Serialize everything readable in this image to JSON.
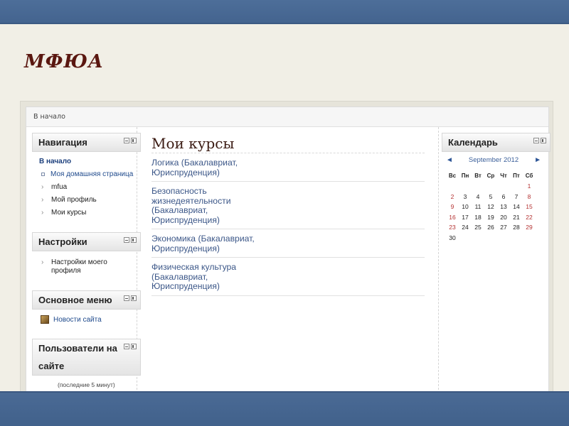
{
  "site": {
    "logo": "МФЮА"
  },
  "breadcrumb": {
    "home": "В начало"
  },
  "navigation": {
    "title": "Навигация",
    "home": "В начало",
    "items": [
      {
        "label": "Моя домашняя страница",
        "type": "square"
      },
      {
        "label": "mfua",
        "type": "chevron"
      },
      {
        "label": "Мой профиль",
        "type": "chevron"
      },
      {
        "label": "Мои курсы",
        "type": "chevron"
      }
    ]
  },
  "settings": {
    "title": "Настройки",
    "items": [
      {
        "label": "Настройки моего профиля"
      }
    ]
  },
  "main_menu": {
    "title": "Основное меню",
    "items": [
      {
        "label": "Новости сайта",
        "icon": "forum-icon"
      }
    ]
  },
  "online_users": {
    "title": "Пользователи на сайте",
    "note": "(последние 5 минут)"
  },
  "main": {
    "title": "Мои курсы",
    "courses": [
      {
        "name": "Логика (Бакалавриат, Юриспруденция)"
      },
      {
        "name": "Безопасность жизнедеятельности (Бакалавриат, Юриспруденция)"
      },
      {
        "name": "Экономика (Бакалавриат, Юриспруденция)"
      },
      {
        "name": "Физическая культура (Бакалавриат, Юриспруденция)"
      }
    ]
  },
  "calendar": {
    "title": "Календарь",
    "month": "September 2012",
    "prev": "◄",
    "next": "►",
    "weekdays": [
      "Вс",
      "Пн",
      "Вт",
      "Ср",
      "Чт",
      "Пт",
      "Сб"
    ],
    "weeks": [
      [
        "",
        "",
        "",
        "",
        "",
        "",
        "1"
      ],
      [
        "2",
        "3",
        "4",
        "5",
        "6",
        "7",
        "8"
      ],
      [
        "9",
        "10",
        "11",
        "12",
        "13",
        "14",
        "15"
      ],
      [
        "16",
        "17",
        "18",
        "19",
        "20",
        "21",
        "22"
      ],
      [
        "23",
        "24",
        "25",
        "26",
        "27",
        "28",
        "29"
      ],
      [
        "30",
        "",
        "",
        "",
        "",
        "",
        ""
      ]
    ]
  },
  "colors": {
    "band": "#4a6a95",
    "logo": "#5a1710",
    "link": "#3c5788",
    "weekend": "#b43232"
  }
}
